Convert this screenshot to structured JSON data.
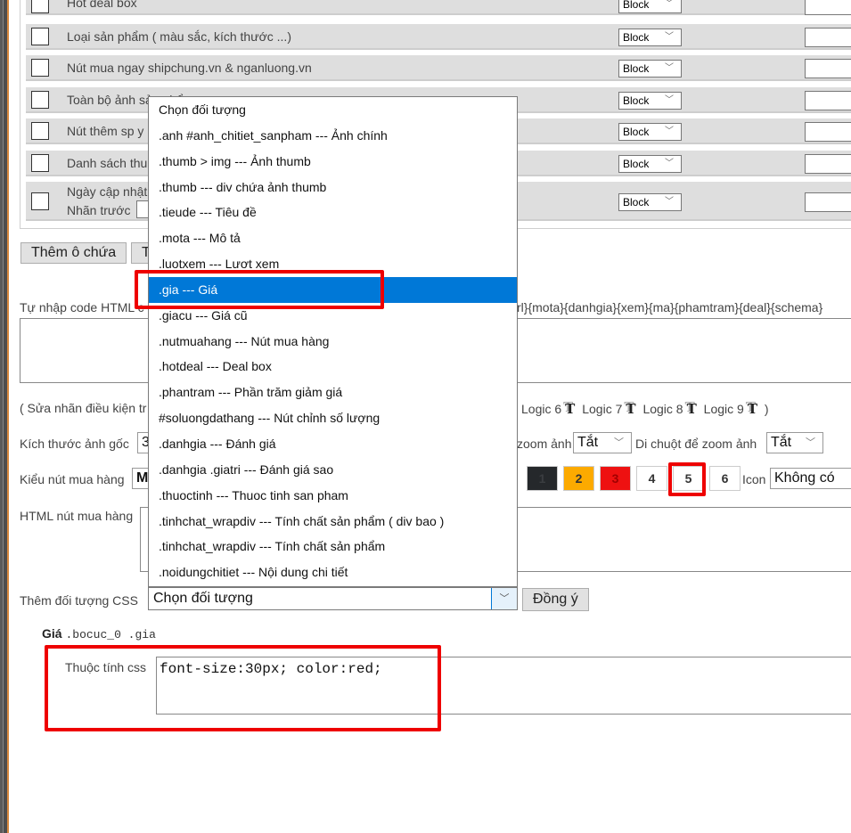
{
  "rows": [
    {
      "label": "Hot deal box",
      "display": "Block"
    },
    {
      "label": "Loại sản phẩm ( màu sắc, kích thước ...)",
      "display": "Block"
    },
    {
      "label": "Nút mua ngay shipchung.vn & nganluong.vn",
      "display": "Block"
    },
    {
      "label": "Toàn bộ ảnh sản phẩm",
      "display": "Block"
    },
    {
      "label": "Nút thêm sp y",
      "display": "Block"
    },
    {
      "label": "Danh sách thu",
      "display": "Block"
    },
    {
      "label": "Ngày cập nhật",
      "label2": "Nhãn trước",
      "display": "Block"
    }
  ],
  "buttons": {
    "add_container": "Thêm ô chứa",
    "second": "T",
    "agree": "Đồng ý"
  },
  "html_code": {
    "label": "Tự nhập code HTML c",
    "tokens": "rl}{mota}{danhgia}{xem}{ma}{phamtram}{deal}{schema}"
  },
  "logic": {
    "prefix": "( Sửa nhãn điều kiện tr",
    "items": [
      "Logic 6",
      "Logic 7",
      "Logic 8",
      "Logic 9"
    ],
    "suffix": ")",
    "icon": "T"
  },
  "image_size": {
    "label": "Kích thước ảnh gốc",
    "value": "3",
    "zoom_label": "zoom ảnh",
    "zoom_value": "Tắt",
    "hover_zoom_label": "Di chuột để zoom ảnh",
    "hover_zoom_value": "Tắt"
  },
  "buy_button": {
    "label": "Kiểu nút mua hàng",
    "value": "M",
    "styles": [
      {
        "num": "1",
        "bg": "#25282b",
        "fg": "#3a3d40"
      },
      {
        "num": "2",
        "bg": "#fcaa00",
        "fg": "#333333"
      },
      {
        "num": "3",
        "bg": "#ee1111",
        "fg": "#a00000"
      },
      {
        "num": "4",
        "bg": "#ffffff",
        "fg": "#333333"
      },
      {
        "num": "5",
        "bg": "#ffffff",
        "fg": "#333333"
      },
      {
        "num": "6",
        "bg": "#ffffff",
        "fg": "#333333"
      }
    ],
    "selected_style": "5",
    "icon_label": "Icon",
    "icon_value": "Không có"
  },
  "html_buy": {
    "label": "HTML nút mua hàng"
  },
  "css_object": {
    "label": "Thêm đối tượng CSS",
    "selected": "Chọn đối tượng",
    "options": [
      "Chọn đối tượng",
      ".anh #anh_chitiet_sanpham --- Ảnh chính",
      ".thumb > img --- Ảnh thumb",
      ".thumb --- div chứa ảnh thumb",
      ".tieude --- Tiêu đề",
      ".mota --- Mô tả",
      ".luotxem --- Lươt xem",
      ".gia --- Giá",
      ".giacu --- Giá cũ",
      ".nutmuahang --- Nút mua hàng",
      ".hotdeal --- Deal box",
      ".phantram --- Phần trăm giảm giá",
      "#soluongdathang --- Nút chỉnh số lượng",
      ".danhgia --- Đánh giá",
      ".danhgia .giatri --- Đánh giá sao",
      ".thuoctinh --- Thuoc tinh san pham",
      ".tinhchat_wrapdiv --- Tính chất sản phẩm ( div bao )",
      ".tinhchat_wrapdiv --- Tính chất sản phẩm",
      ".noidungchitiet --- Nội dung chi tiết"
    ],
    "highlighted_index": 7
  },
  "css_entry": {
    "title": "Giá",
    "selector": ".bocuc_0 .gia",
    "prop_label": "Thuộc tính css",
    "value": "font-size:30px; color:red;"
  },
  "colors": {
    "highlight": "#0078d7",
    "annotation": "#ee0000"
  }
}
